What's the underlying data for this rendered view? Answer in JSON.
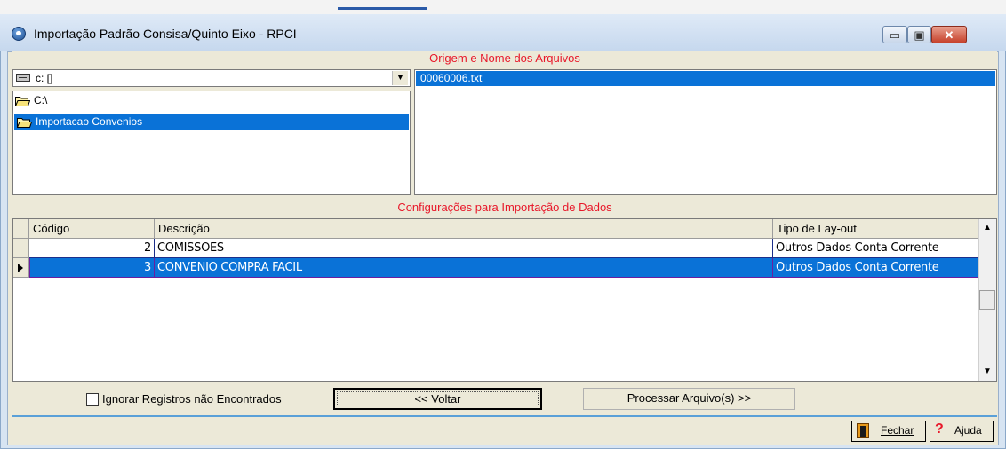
{
  "window": {
    "title": "Importação Padrão Consisa/Quinto Eixo - RPCI",
    "controls": {
      "minimize": "▭",
      "maximize": "▣",
      "close": "✕"
    }
  },
  "files_section": {
    "header": "Origem e Nome dos Arquivos",
    "drive": {
      "value": "c: []",
      "arrow": "▼"
    },
    "directories": [
      {
        "label": "C:\\",
        "selected": false
      },
      {
        "label": "Importacao Convenios",
        "selected": true
      }
    ],
    "files": [
      {
        "label": "00060006.txt",
        "selected": true
      }
    ]
  },
  "config_section": {
    "header": "Configurações para Importação de Dados",
    "columns": {
      "codigo": "Código",
      "descricao": "Descrição",
      "tipo": "Tipo de Lay-out"
    },
    "rows": [
      {
        "codigo": "2",
        "descricao": "COMISSOES",
        "tipo": "Outros Dados Conta Corrente",
        "selected": false
      },
      {
        "codigo": "3",
        "descricao": "CONVENIO COMPRA FACIL",
        "tipo": "Outros Dados Conta Corrente",
        "selected": true
      }
    ],
    "scrollbar": {
      "up": "▲",
      "down": "▼"
    }
  },
  "actions": {
    "ignore_label": "Ignorar Registros não Encontrados",
    "ignore_checked": false,
    "voltar_label": "<< Voltar",
    "processar_label": "Processar Arquivo(s) >>"
  },
  "footer": {
    "fechar_label": "Fechar",
    "ajuda_label": "Ajuda",
    "ajuda_icon_glyph": "?"
  },
  "colors": {
    "selection": "#0a72d7",
    "section_header_text": "#e8182a",
    "panel_bg": "#ece9d8"
  }
}
